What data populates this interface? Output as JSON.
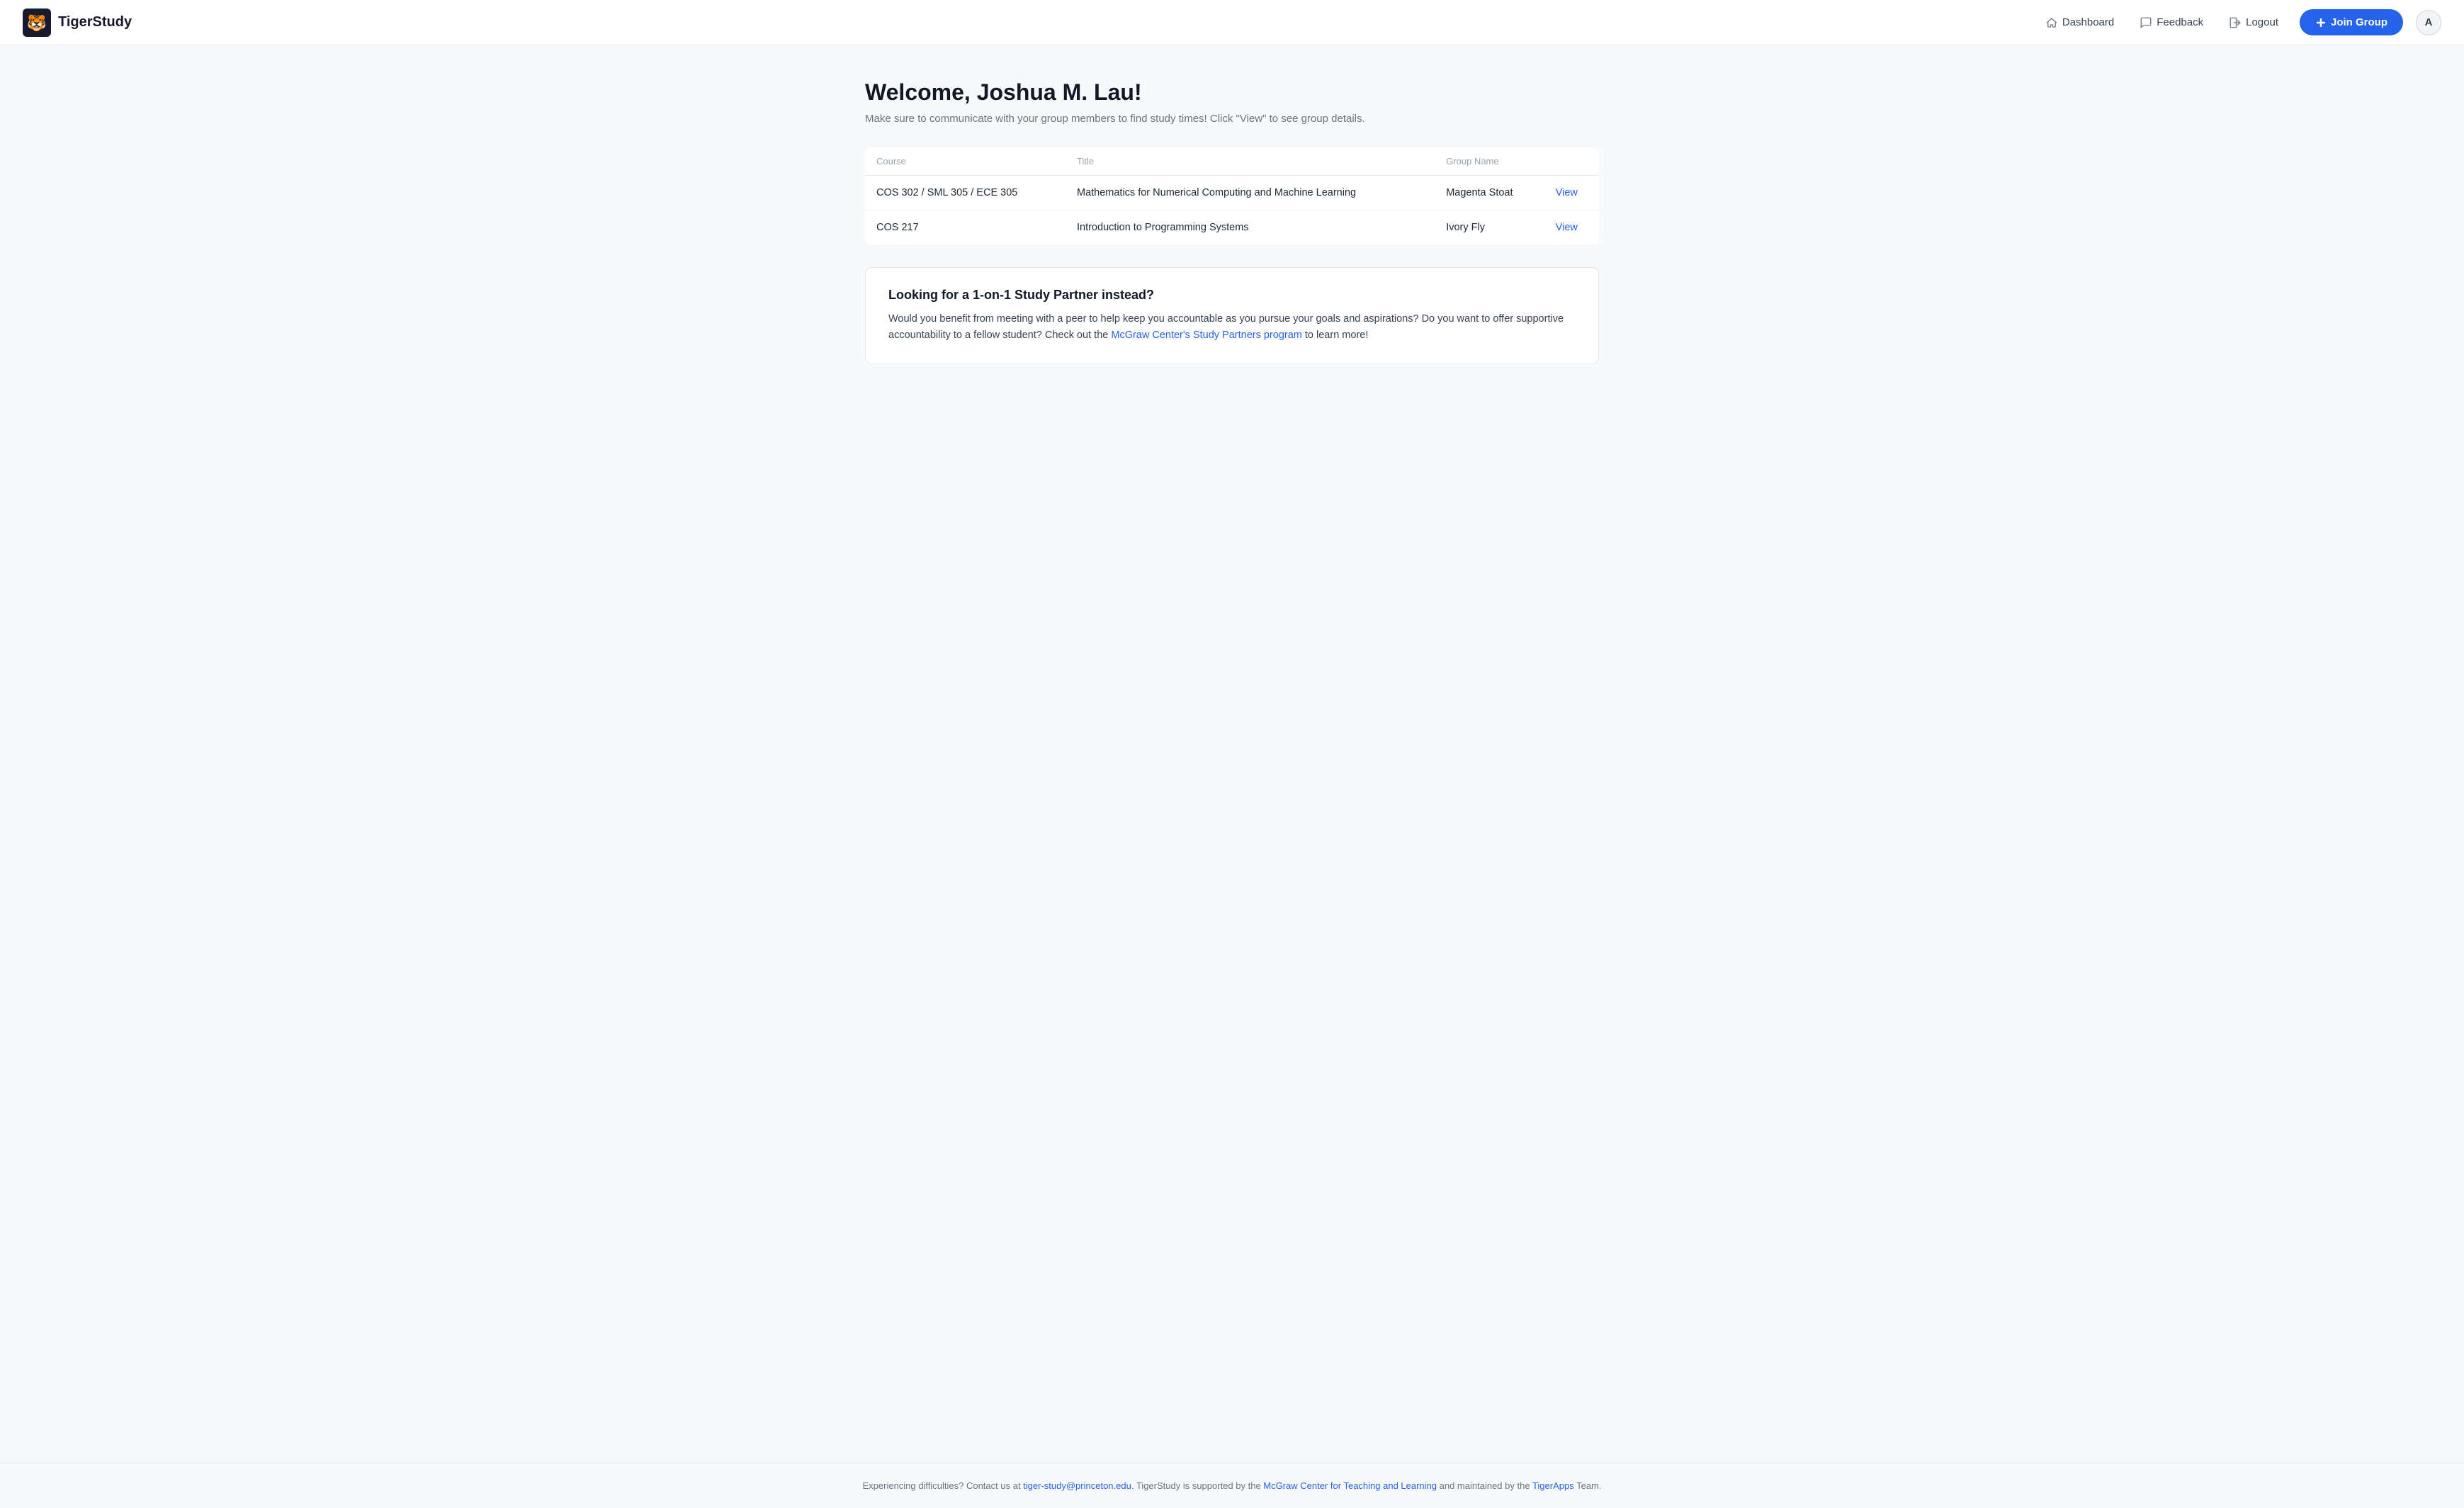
{
  "brand": {
    "name": "TigerStudy"
  },
  "nav": {
    "dashboard_label": "Dashboard",
    "feedback_label": "Feedback",
    "logout_label": "Logout",
    "join_group_label": "Join Group",
    "avatar_label": "A"
  },
  "welcome": {
    "title": "Welcome, Joshua M. Lau!",
    "subtitle": "Make sure to communicate with your group members to find study times! Click \"View\" to see group details."
  },
  "table": {
    "headers": [
      "Course",
      "Title",
      "Group Name"
    ],
    "rows": [
      {
        "course": "COS 302 / SML 305 / ECE 305",
        "title": "Mathematics for Numerical Computing and Machine Learning",
        "group_name": "Magenta Stoat",
        "view_label": "View"
      },
      {
        "course": "COS 217",
        "title": "Introduction to Programming Systems",
        "group_name": "Ivory Fly",
        "view_label": "View"
      }
    ]
  },
  "study_partner_card": {
    "title": "Looking for a 1-on-1 Study Partner instead?",
    "text_before": "Would you benefit from meeting with a peer to help keep you accountable as you pursue your goals and aspirations? Do you want to offer supportive accountability to a fellow student? Check out the ",
    "link_label": "McGraw Center's Study Partners program",
    "link_href": "#",
    "text_after": " to learn more!"
  },
  "footer": {
    "text_before": "Experiencing difficulties? Contact us at ",
    "email_label": "tiger-study@princeton.edu",
    "email_href": "mailto:tiger-study@princeton.edu",
    "text_middle": ". TigerStudy is supported by the ",
    "mcgraw_label": "McGraw Center for Teaching and Learning",
    "mcgraw_href": "#",
    "text_end": " and maintained by the ",
    "tigerapps_label": "TigerApps",
    "tigerapps_href": "#",
    "text_final": " Team."
  }
}
